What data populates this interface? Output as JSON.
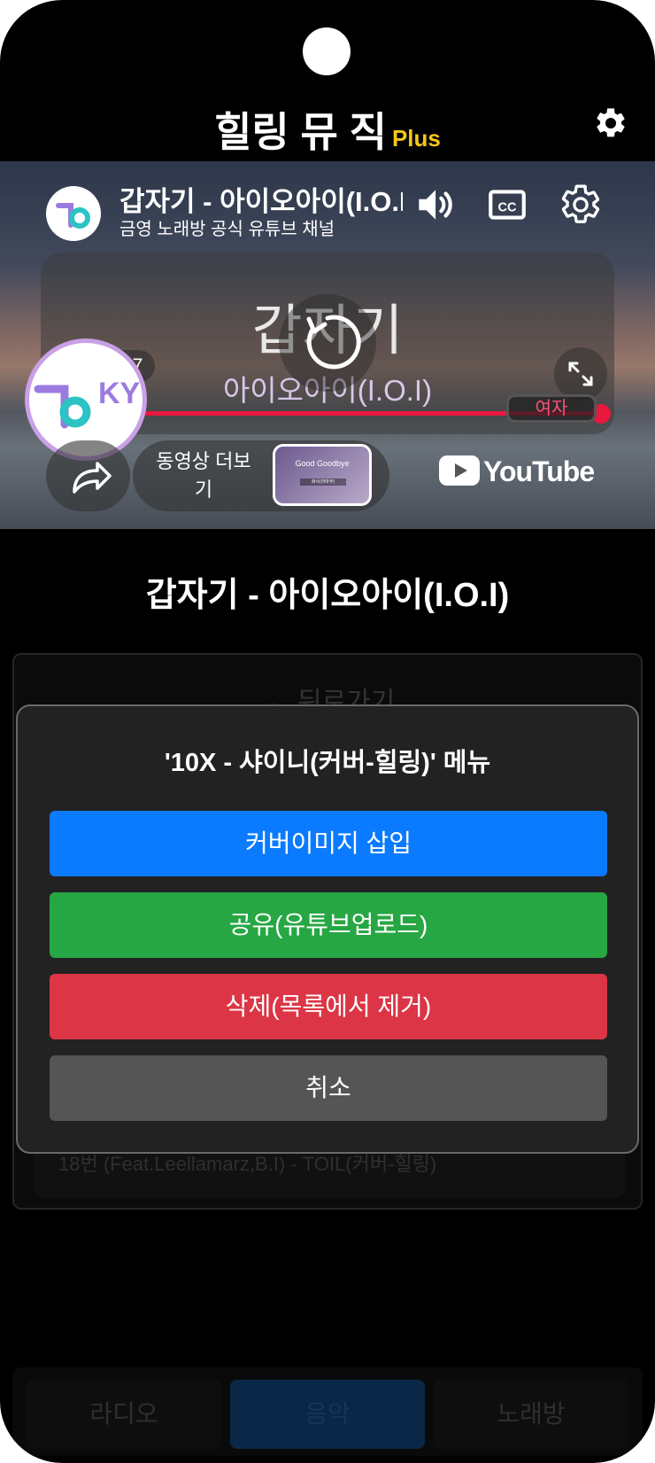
{
  "header": {
    "title": "힐링 뮤 직",
    "badge": "Plus"
  },
  "player": {
    "video_title": "갑자기 - 아이오아이(I.O.I)",
    "channel_name": "금영 노래방 공식 유튜브 채널",
    "lyric_main": "갑자기",
    "lyric_sub": "아이오아이(I.O.I)",
    "time": "3:17 / 3:17",
    "progress_fraction": 1.0,
    "voice_tag": "여자",
    "logo_text": "KY",
    "more_videos_label": "동영상 더보기",
    "thumb_title": "Good Goodbye",
    "thumb_sub": "화사(마마무)",
    "youtube_label": "YouTube"
  },
  "main": {
    "song_title": "갑자기 - 아이오아이(I.O.I)",
    "back_label": "← 뒤로가기",
    "list_item_behind": "18번 (Feat.Leellamarz,B.I) - TOIL(커버-힐링)"
  },
  "modal": {
    "title": "'10X - 샤이니(커버-힐링)' 메뉴",
    "cover_label": "커버이미지 삽입",
    "share_label": "공유(유튜브업로드)",
    "delete_label": "삭제(목록에서 제거)",
    "cancel_label": "취소"
  },
  "bottom_nav": {
    "radio": "라디오",
    "music": "음악",
    "karaoke": "노래방",
    "active": "music"
  },
  "colors": {
    "accent_blue": "#0a7bff",
    "share_green": "#27a744",
    "delete_red": "#dc3545",
    "cancel_gray": "#555555",
    "plus_yellow": "#f5c518",
    "progress_red": "#e8183c"
  }
}
